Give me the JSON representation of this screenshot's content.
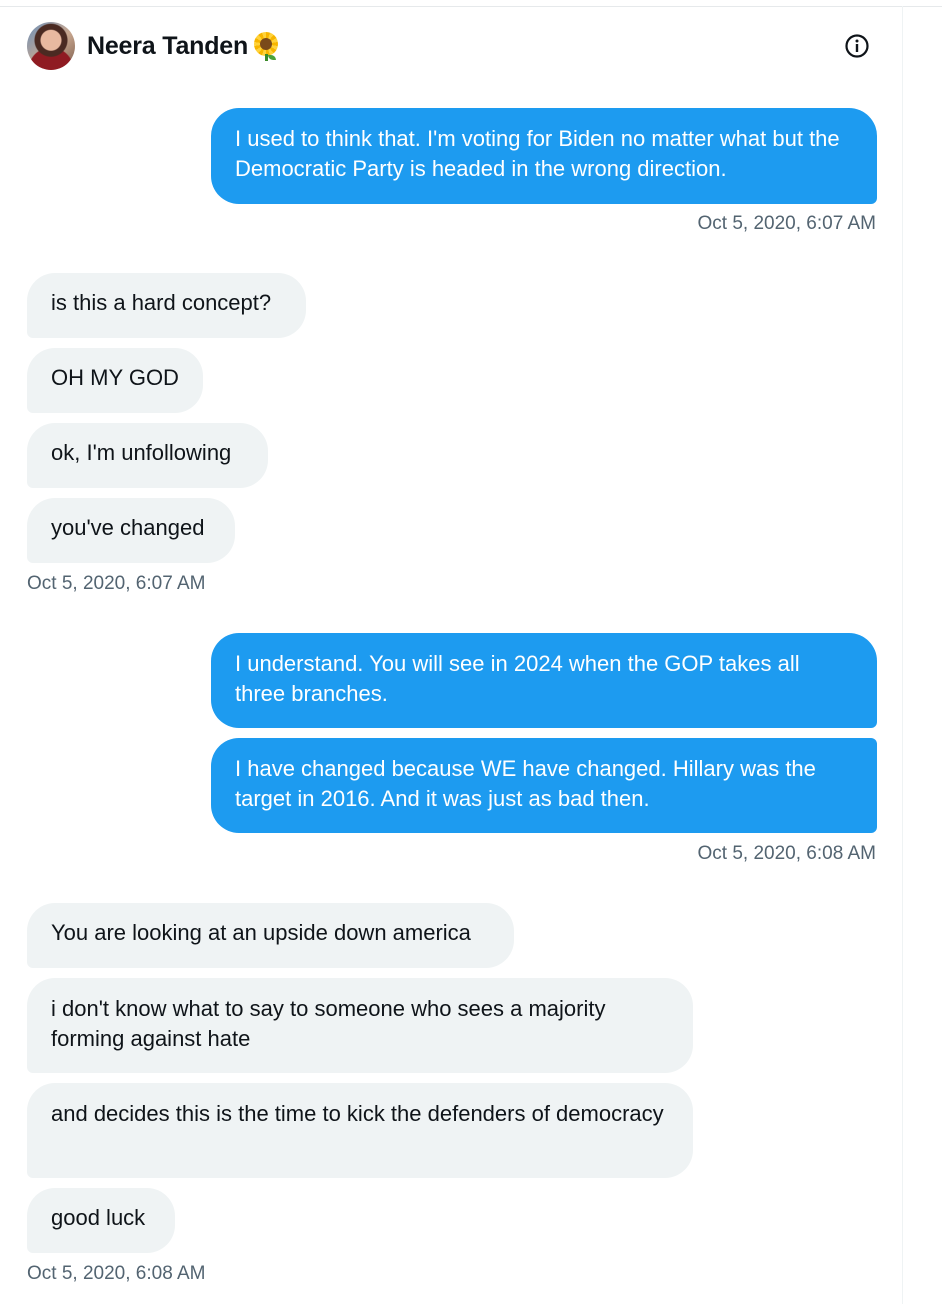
{
  "header": {
    "display_name": "Neera Tanden",
    "name_emoji": "sunflower-icon",
    "info_icon": "info-icon"
  },
  "colors": {
    "sent_bubble": "#1d9bf0",
    "received_bubble": "#eff3f4",
    "timestamp": "#536471"
  },
  "messages": [
    {
      "direction": "sent",
      "text": "I used to think that. I'm voting for Biden no matter what but the Democratic Party is headed in the wrong direction."
    },
    {
      "direction": "timestamp",
      "text": "Oct 5, 2020, 6:07 AM"
    },
    {
      "direction": "received",
      "text": "is this a hard concept?"
    },
    {
      "direction": "received",
      "text": "OH MY GOD"
    },
    {
      "direction": "received",
      "text": "ok, I'm unfollowing"
    },
    {
      "direction": "received",
      "text": "you've changed"
    },
    {
      "direction": "timestamp",
      "text": "Oct 5, 2020, 6:07 AM"
    },
    {
      "direction": "sent",
      "text": "I understand. You will see in 2024 when the GOP takes all three branches."
    },
    {
      "direction": "sent",
      "text": "I have changed because WE have changed. Hillary was the target in 2016. And it was just as bad then."
    },
    {
      "direction": "timestamp",
      "text": "Oct 5, 2020, 6:08 AM"
    },
    {
      "direction": "received",
      "text": "You are looking at an upside down america"
    },
    {
      "direction": "received",
      "text": "i don't know what to say to someone who sees a majority forming against hate"
    },
    {
      "direction": "received",
      "text": "and decides this is the time to kick the defenders of democracy"
    },
    {
      "direction": "received",
      "text": "good luck"
    },
    {
      "direction": "timestamp",
      "text": "Oct 5, 2020, 6:08 AM"
    }
  ]
}
